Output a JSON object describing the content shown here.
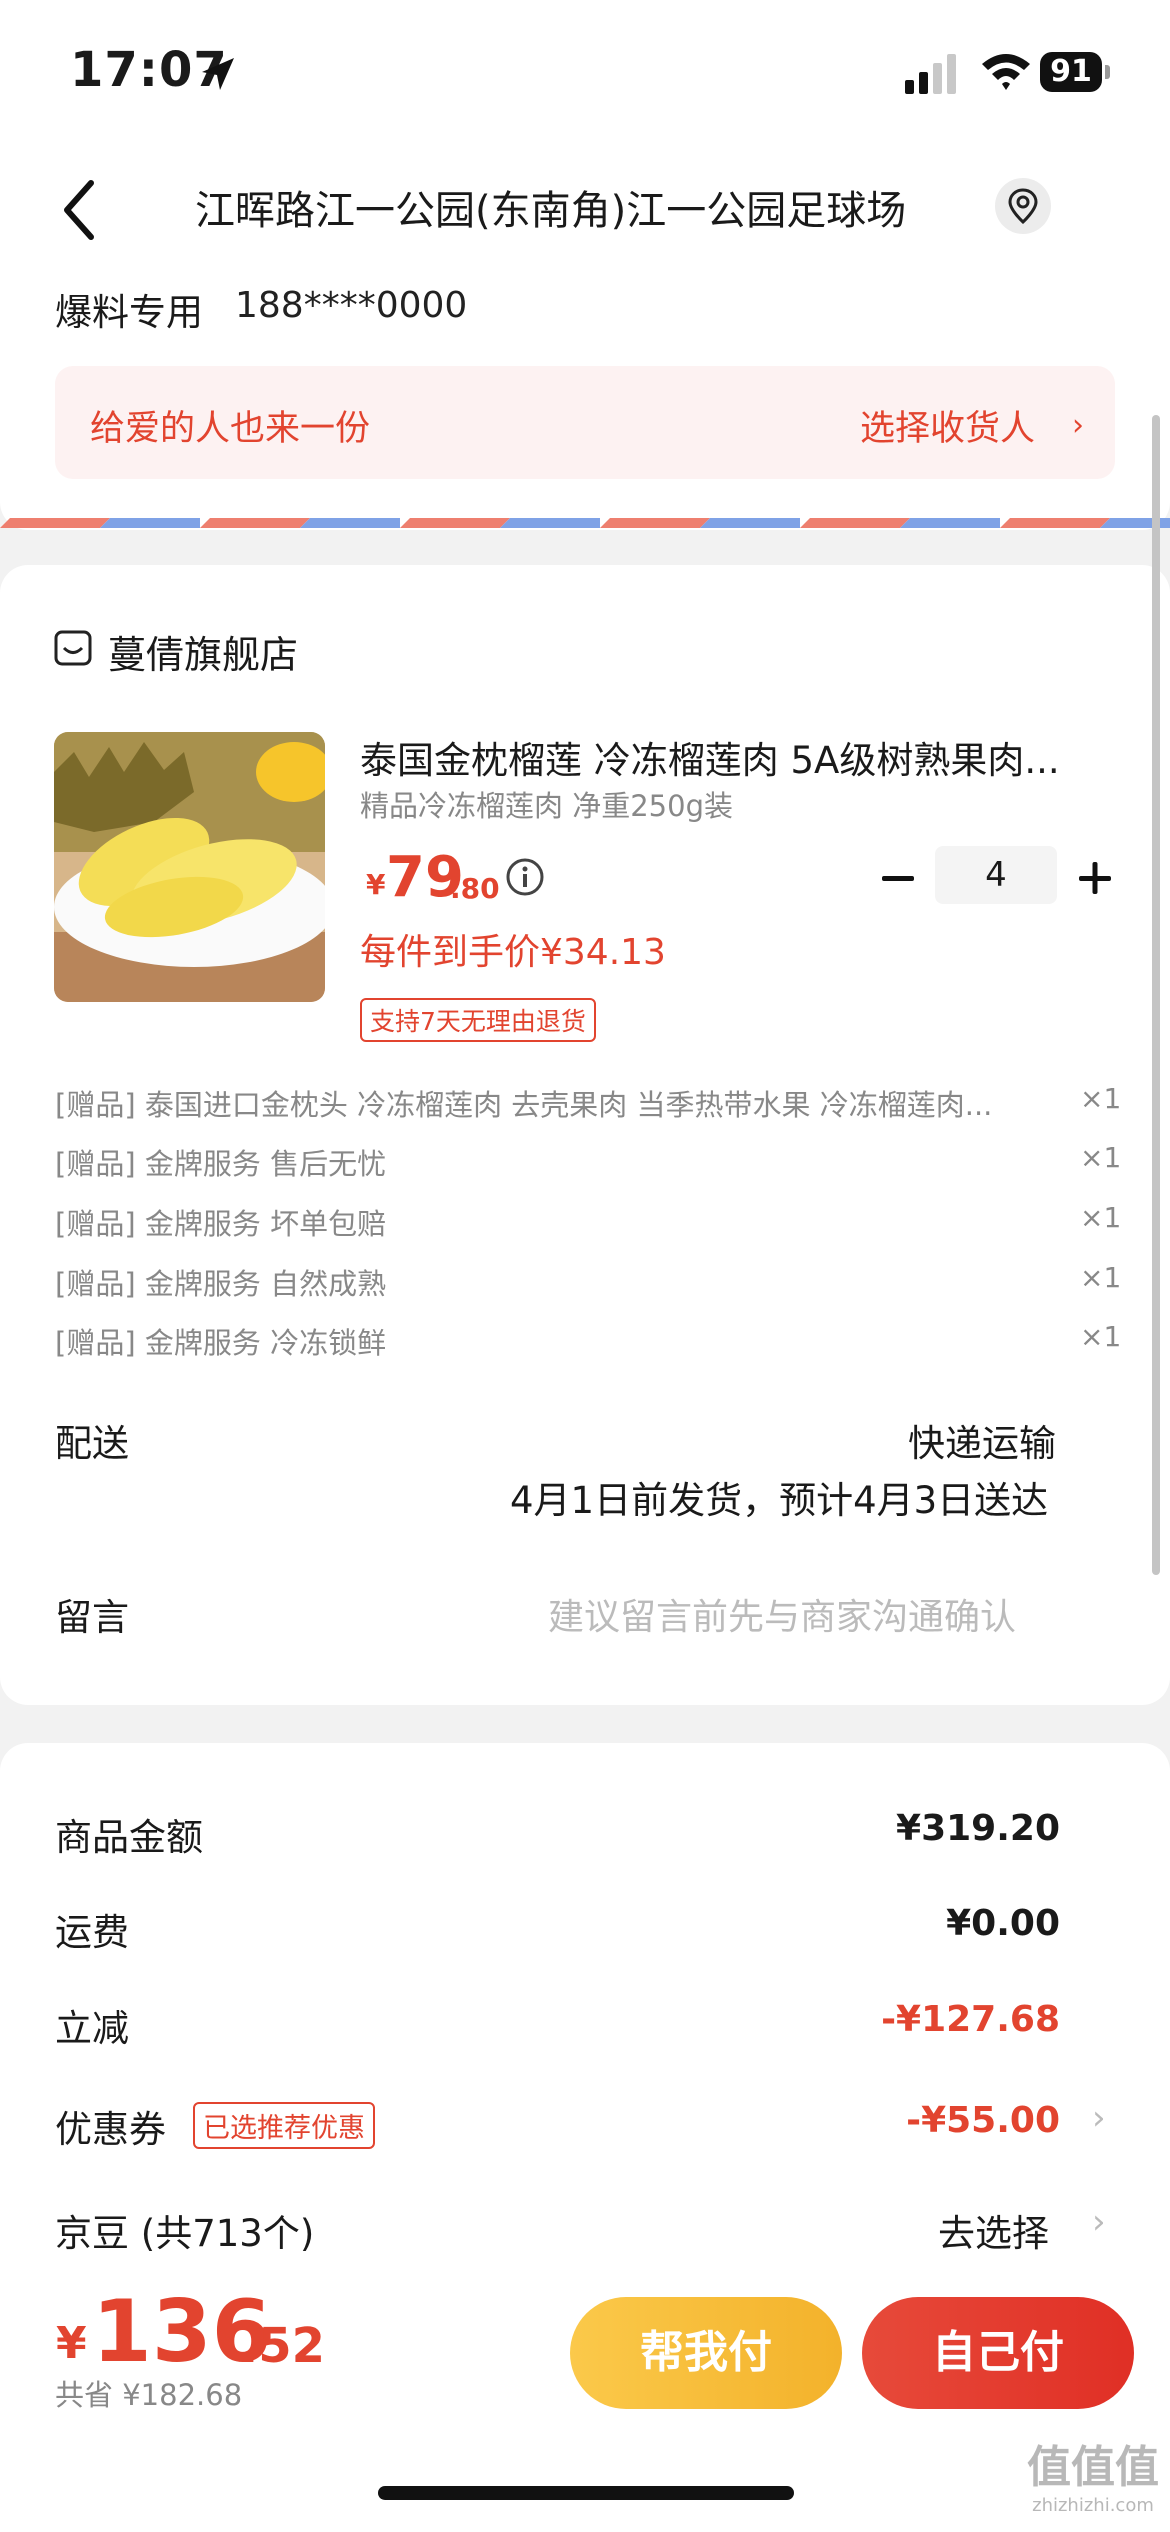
{
  "status_bar": {
    "time": "17:07",
    "battery": "91"
  },
  "address": {
    "text": "江晖路江一公园(东南角)江一公园足球场",
    "contact_name": "爆料专用",
    "contact_phone": "188****0000"
  },
  "gift_banner": {
    "text": "给爱的人也来一份",
    "link": "选择收货人",
    "chevron": "›"
  },
  "store": {
    "name": "蔓倩旗舰店"
  },
  "product": {
    "title": "泰国金枕榴莲 冷冻榴莲肉 5A级树熟果肉...",
    "spec": "精品冷冻榴莲肉 净重250g装",
    "price_symbol": "¥",
    "price_int": "79",
    "price_dec": ".80",
    "quantity": "4",
    "unit_price": "每件到手价¥34.13",
    "return_policy": "支持7天无理由退货"
  },
  "gifts": [
    {
      "label": "[赠品] 泰国进口金枕头 冷冻榴莲肉 去壳果肉 当季热带水果 冷冻榴莲肉...",
      "qty": "×1"
    },
    {
      "label": "[赠品] 金牌服务 售后无忧",
      "qty": "×1"
    },
    {
      "label": "[赠品] 金牌服务 坏单包赔",
      "qty": "×1"
    },
    {
      "label": "[赠品] 金牌服务 自然成熟",
      "qty": "×1"
    },
    {
      "label": "[赠品] 金牌服务 冷冻锁鲜",
      "qty": "×1"
    }
  ],
  "shipping": {
    "label": "配送",
    "method": "快递运输",
    "date": "4月1日前发货，预计4月3日送达"
  },
  "message": {
    "label": "留言",
    "placeholder": "建议留言前先与商家沟通确认"
  },
  "costs": {
    "goods_label": "商品金额",
    "goods_value": "¥319.20",
    "freight_label": "运费",
    "freight_value": "¥0.00",
    "discount_label": "立减",
    "discount_value": "-¥127.68",
    "coupon_label": "优惠券",
    "coupon_tag": "已选推荐优惠",
    "coupon_value": "-¥55.00",
    "jd_label": "京豆 (共713个)",
    "jd_action": "去选择",
    "chevron": "›"
  },
  "bottom": {
    "total_symbol": "¥",
    "total_int": "136",
    "total_dec": ".52",
    "saved": "共省 ¥182.68",
    "help_pay": "帮我付",
    "self_pay": "自己付"
  },
  "watermark": {
    "main": "值值值",
    "sub": "zhizhizhi.com"
  },
  "colors": {
    "accent_red": "#e2442f",
    "accent_yellow": "#f3b22b"
  }
}
